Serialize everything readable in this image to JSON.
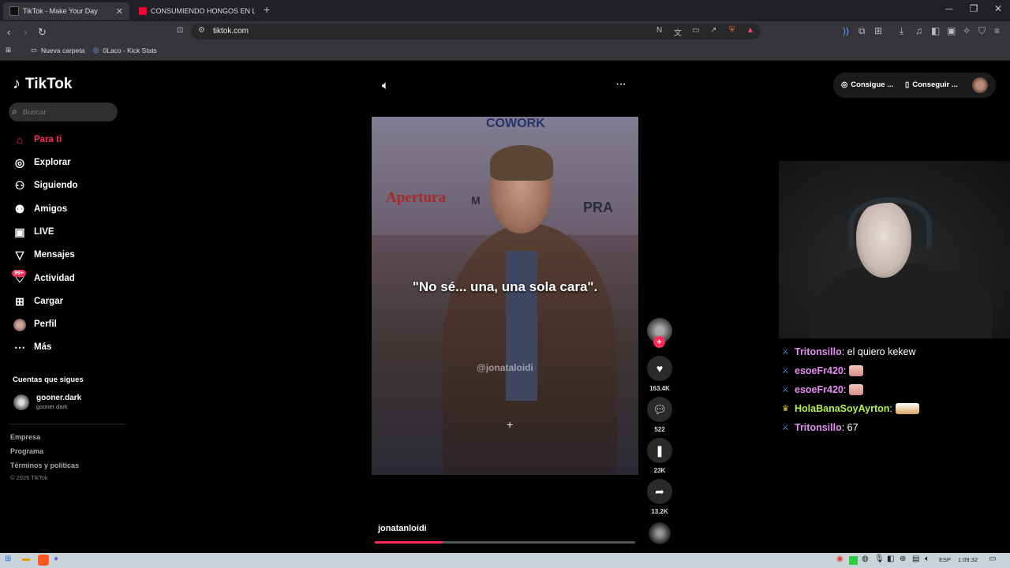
{
  "browser": {
    "tabs": [
      {
        "title": "TikTok - Make Your Day",
        "active": true,
        "favicon_color": "#111111"
      },
      {
        "title": "CONSUMIENDO HONGOS EN LAS S",
        "active": false,
        "favicon_color": "#ff0033"
      }
    ],
    "url": "tiktok.com",
    "bookmarks": [
      {
        "label": "Nueva carpeta",
        "icon": "folder-icon"
      },
      {
        "label": "0Laco - Kick Stats",
        "icon": "kick-stats-icon"
      }
    ]
  },
  "tiktok": {
    "brand": "TikTok",
    "search": {
      "placeholder": "Buscar"
    },
    "nav": [
      {
        "label": "Para ti",
        "icon": "home-icon",
        "active": true
      },
      {
        "label": "Explorar",
        "icon": "compass-icon"
      },
      {
        "label": "Siguiendo",
        "icon": "following-icon"
      },
      {
        "label": "Amigos",
        "icon": "friends-icon"
      },
      {
        "label": "LIVE",
        "icon": "live-icon"
      },
      {
        "label": "Mensajes",
        "icon": "messages-icon"
      },
      {
        "label": "Actividad",
        "icon": "activity-icon",
        "badge": "99+"
      },
      {
        "label": "Cargar",
        "icon": "upload-icon"
      },
      {
        "label": "Perfil",
        "icon": "profile-avatar"
      },
      {
        "label": "Más",
        "icon": "more-icon"
      }
    ],
    "following_section": {
      "title": "Cuentas que sigues",
      "accounts": [
        {
          "name": "gooner.dark",
          "handle": "gooner.dark"
        }
      ]
    },
    "footer": {
      "links": [
        "Empresa",
        "Programa",
        "Términos y políticas"
      ],
      "copyright": "© 2026 TikTok"
    },
    "top_buttons": [
      {
        "label": "Consigue ...",
        "icon": "coin-icon"
      },
      {
        "label": "Conseguir ...",
        "icon": "phone-icon"
      }
    ],
    "video": {
      "caption": "\"No sé... una, una sola cara\".",
      "watermark": "@jonataloidi",
      "author": "jonatanloidi",
      "progress": 0.26,
      "background_text": {
        "top": "COWORK",
        "left": "Apertura",
        "middle": "M",
        "right": "PRA"
      }
    },
    "actions": {
      "likes": "163.4K",
      "comments": "522",
      "saves": "23K",
      "shares": "13.2K"
    },
    "accent_color": "#fe2c55"
  },
  "stream_chat": [
    {
      "user": "Tritonsillo",
      "message": ": el quiero kekew",
      "color": "#e58ef2",
      "badge": "sword-icon"
    },
    {
      "user": "esoeFr420",
      "message": ":",
      "color": "#e58ef2",
      "badge": "sword-icon",
      "emote": true
    },
    {
      "user": "esoeFr420",
      "message": ":",
      "color": "#e58ef2",
      "badge": "sword-icon",
      "emote": true
    },
    {
      "user": "HolaBanaSoyAyrton",
      "message": ":",
      "color": "#b7f04c",
      "badge": "crown-icon",
      "emote": true
    },
    {
      "user": "Tritonsillo",
      "message": ": 67",
      "color": "#e58ef2",
      "badge": "sword-icon"
    }
  ],
  "taskbar": {
    "language": "ESP",
    "clock": "1:09:32"
  }
}
